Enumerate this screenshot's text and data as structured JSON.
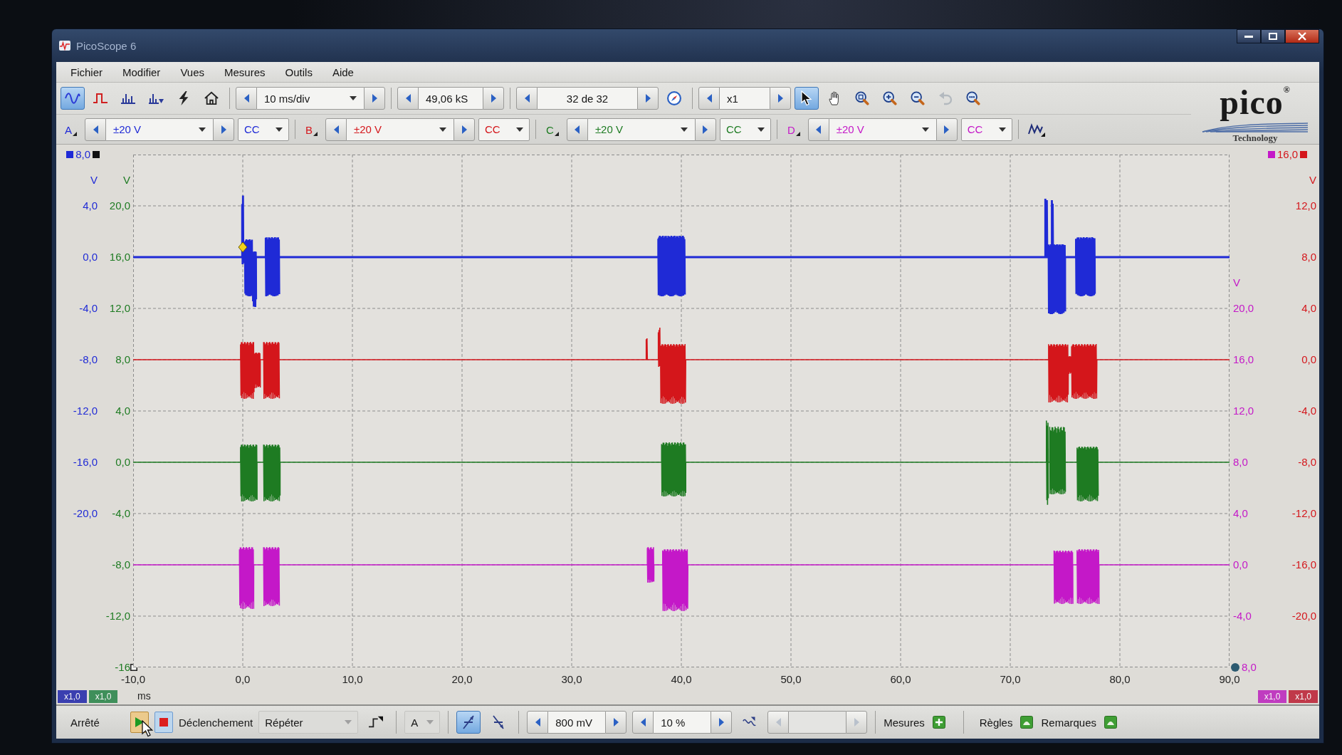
{
  "window": {
    "title": "PicoScope 6"
  },
  "menu": [
    "Fichier",
    "Modifier",
    "Vues",
    "Mesures",
    "Outils",
    "Aide"
  ],
  "toolbar": {
    "views": [
      {
        "kind": "sine",
        "selected": true
      },
      {
        "kind": "pulse",
        "selected": false
      },
      {
        "kind": "bars",
        "selected": false
      },
      {
        "kind": "barsarrow",
        "selected": false
      }
    ],
    "actions": [
      {
        "kind": "lightning"
      },
      {
        "kind": "home"
      }
    ],
    "timebase": "10 ms/div",
    "samples": "49,06 kS",
    "buffer": "32 de 32",
    "zoom": "x1",
    "tools": [
      {
        "kind": "pointer",
        "selected": true,
        "disabled": false
      },
      {
        "kind": "hand",
        "selected": false,
        "disabled": false
      },
      {
        "kind": "zoomfit",
        "selected": false,
        "disabled": false
      },
      {
        "kind": "zoomin",
        "selected": false,
        "disabled": false
      },
      {
        "kind": "zoomout",
        "selected": false,
        "disabled": false
      },
      {
        "kind": "undo",
        "selected": false,
        "disabled": true
      },
      {
        "kind": "zoomfull",
        "selected": false,
        "disabled": false
      }
    ]
  },
  "logo": {
    "wordmark": "pico$^{®}$",
    "tagline": "Technology"
  },
  "channels": [
    {
      "letter": "A",
      "color": "#1f2ad6",
      "range": "±20 V",
      "coupling": "CC"
    },
    {
      "letter": "B",
      "color": "#d4161b",
      "range": "±20 V",
      "coupling": "CC"
    },
    {
      "letter": "C",
      "color": "#1e7b22",
      "range": "±20 V",
      "coupling": "CC"
    },
    {
      "letter": "D",
      "color": "#c418c8",
      "range": "±20 V",
      "coupling": "CC"
    }
  ],
  "graph": {
    "left_axes": [
      {
        "color": "#1f2ad6",
        "header": "8,0",
        "unit": "V",
        "ticks": [
          "4,0",
          "0,0",
          "-4,0",
          "-8,0",
          "-12,0",
          "-16,0",
          "-20,0"
        ]
      },
      {
        "color": "#1e7b22",
        "unit": "V",
        "ticks": [
          "20,0",
          "16,0",
          "12,0",
          "8,0",
          "4,0",
          "0,0",
          "-4,0",
          "-8,0",
          "-12,0",
          "-16"
        ]
      }
    ],
    "right_axes": [
      {
        "color": "#c418c8",
        "unit": "V",
        "ticks": [
          "20,0",
          "16,0",
          "12,0",
          "8,0",
          "4,0",
          "0,0",
          "-4,0"
        ],
        "footer": "8,0"
      },
      {
        "color": "#d4161b",
        "header": "16,0",
        "unit": "V",
        "ticks": [
          "12,0",
          "8,0",
          "4,0",
          "0,0",
          "-4,0",
          "-8,0",
          "-12,0",
          "-16,0",
          "-20,0"
        ]
      }
    ],
    "time_axis": {
      "ticks": [
        "-10,0",
        "0,0",
        "10,0",
        "20,0",
        "30,0",
        "40,0",
        "50,0",
        "60,0",
        "70,0",
        "80,0",
        "90,0"
      ],
      "unit": "ms"
    },
    "scale_tags_left": [
      {
        "text": "x1,0",
        "color": "#3a3fb0"
      },
      {
        "text": "x1,0",
        "color": "#3f8f5a"
      }
    ],
    "scale_tags_right": [
      {
        "text": "x1,0",
        "color": "#c03cc0"
      },
      {
        "text": "x1,0",
        "color": "#c0394a"
      }
    ]
  },
  "status_bar": {
    "state": "Arrêté",
    "run_buttons": [
      {
        "kind": "run",
        "selected": false,
        "hover": true
      },
      {
        "kind": "stop",
        "selected": true,
        "hover": false
      }
    ],
    "trigger_label": "Déclenchement",
    "trigger_mode": "Répéter",
    "trigger_source": "A",
    "edges": [
      {
        "kind": "rising",
        "selected": true
      },
      {
        "kind": "falling",
        "selected": false
      }
    ],
    "threshold": "800 mV",
    "pretrigger": "10 %",
    "empty_spinner": {
      "disabled": true
    },
    "measurements": "Mesures",
    "rulers": "Règles",
    "notes": "Remarques"
  }
}
